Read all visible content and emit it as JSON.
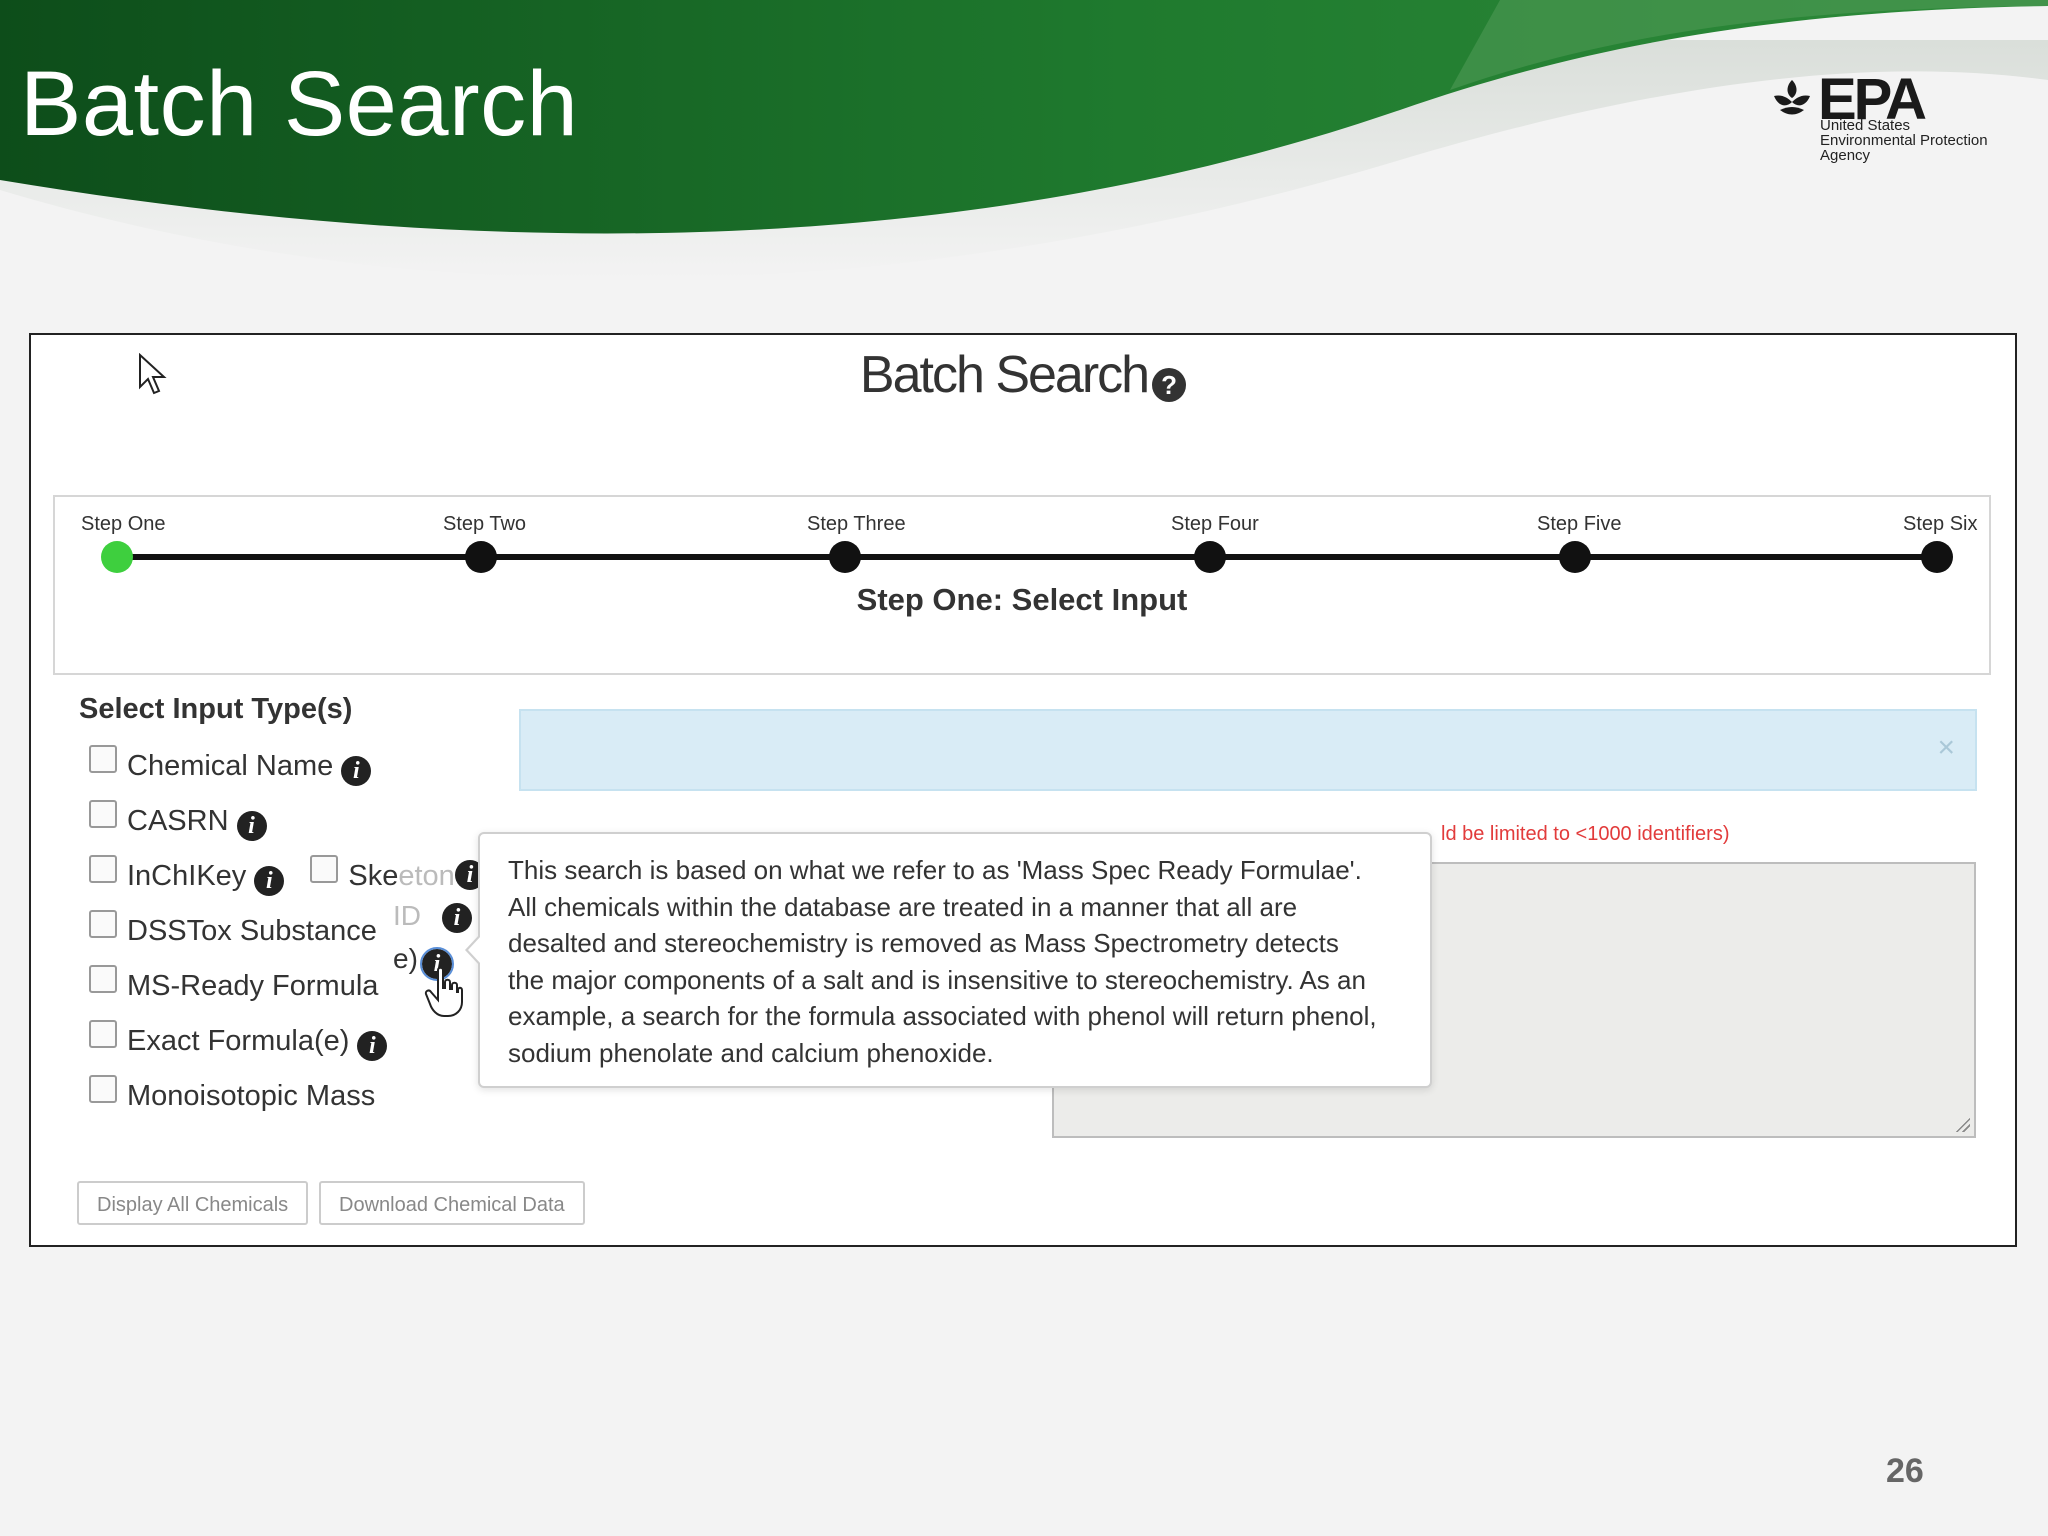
{
  "slide": {
    "title": "Batch Search",
    "page_number": "26"
  },
  "epa_logo": {
    "wordmark": "EPA",
    "agency_lines": [
      "United States",
      "Environmental Protection",
      "Agency"
    ]
  },
  "app": {
    "title": "Batch Search",
    "help_glyph": "?",
    "steps": [
      "Step One",
      "Step Two",
      "Step Three",
      "Step Four",
      "Step Five",
      "Step Six"
    ],
    "active_step_index": 0,
    "step_heading": "Step One: Select Input",
    "input_types_heading": "Select Input Type(s)",
    "input_types": [
      {
        "label": "Chemical Name",
        "checked": false,
        "info": "i"
      },
      {
        "label": "CASRN",
        "checked": false,
        "info": "i"
      },
      {
        "label": "InChIKey",
        "checked": false,
        "info": "i"
      },
      {
        "label": "DSSTox Substance",
        "checked": false
      },
      {
        "label": "MS-Ready Formula",
        "checked": false
      },
      {
        "label": "Exact Formula(e)",
        "checked": false,
        "info": "i"
      },
      {
        "label": "Monoisotopic Mass",
        "checked": false
      }
    ],
    "partial_labels": {
      "skeleton_visible": "Ske",
      "skeleton_faded": "eton",
      "id_fragment": "ID",
      "e_fragment": "e)"
    },
    "alert_close_glyph": "×",
    "limit_note": "ld be limited to <1000 identifiers)",
    "tooltip_lines": [
      "This search is based on what we refer to as 'Mass Spec Ready Formulae'.",
      "All chemicals within the database are treated in a manner that all are",
      "desalted and stereochemistry is removed as Mass Spectrometry detects",
      "the major components of a salt and is insensitive to stereochemistry. As an",
      "example, a search for the formula associated with phenol will return phenol,",
      "sodium phenolate and calcium phenoxide."
    ],
    "buttons": {
      "display_all": "Display All Chemicals",
      "download": "Download Chemical Data"
    }
  },
  "colors": {
    "banner_green": "#1f7a2e",
    "banner_dark_green": "#0d4d1a",
    "active_step": "#3ecf3e",
    "alert_bg": "#d9ecf6",
    "limit_note_red": "#e23b3b"
  }
}
